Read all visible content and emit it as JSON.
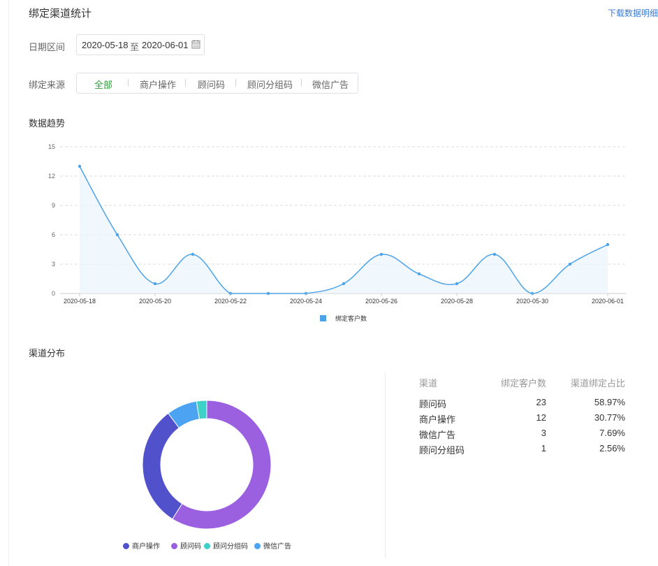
{
  "page": {
    "title": "绑定渠道统计",
    "download_label": "下载数据明细"
  },
  "filters": {
    "date_label": "日期区间",
    "start_date": "2020-05-18",
    "end_date": "2020-06-01",
    "range_sep": "至",
    "source_label": "绑定来源",
    "source_tabs": [
      "全部",
      "商户操作",
      "顾问码",
      "顾问分组码",
      "微信广告"
    ],
    "active_source": "全部"
  },
  "trend": {
    "section_title": "数据趋势",
    "chart_data": {
      "type": "line",
      "x": [
        "2020-05-18",
        "2020-05-19",
        "2020-05-20",
        "2020-05-21",
        "2020-05-22",
        "2020-05-23",
        "2020-05-24",
        "2020-05-25",
        "2020-05-26",
        "2020-05-27",
        "2020-05-28",
        "2020-05-29",
        "2020-05-30",
        "2020-05-31",
        "2020-06-01"
      ],
      "x_tick_labels": [
        "2020-05-18",
        "2020-05-20",
        "2020-05-22",
        "2020-05-24",
        "2020-05-26",
        "2020-05-28",
        "2020-05-30",
        "2020-06-01"
      ],
      "series": [
        {
          "name": "绑定客户数",
          "values": [
            13,
            6,
            1,
            4,
            0,
            0,
            0,
            1,
            4,
            2,
            1,
            4,
            0,
            3,
            5
          ]
        }
      ],
      "ylim": [
        0,
        15
      ],
      "y_ticks": [
        "0",
        "3",
        "6",
        "9",
        "12",
        "15"
      ],
      "grid": true,
      "smooth": true,
      "area": true,
      "legend": "bottom-center",
      "color": "#4da3e8"
    }
  },
  "distribution": {
    "section_title": "渠道分布",
    "chart_data": {
      "type": "pie",
      "donut": true,
      "categories": [
        "顾问码",
        "商户操作",
        "微信广告",
        "顾问分组码"
      ],
      "values": [
        23,
        12,
        3,
        1
      ],
      "colors": [
        "#9a60e0",
        "#5151cc",
        "#4ba3f2",
        "#3fd1c8"
      ],
      "legend": "bottom-center",
      "legend_order": [
        "商户操作",
        "顾问码",
        "顾问分组码",
        "微信广告"
      ]
    },
    "table": {
      "headers": [
        "渠道",
        "绑定客户数",
        "渠道绑定占比"
      ],
      "rows": [
        [
          "顾问码",
          "23",
          "58.97%"
        ],
        [
          "商户操作",
          "12",
          "30.77%"
        ],
        [
          "微信广告",
          "3",
          "7.69%"
        ],
        [
          "顾问分组码",
          "1",
          "2.56%"
        ]
      ]
    }
  },
  "icons": {
    "calendar": "calendar-icon"
  }
}
